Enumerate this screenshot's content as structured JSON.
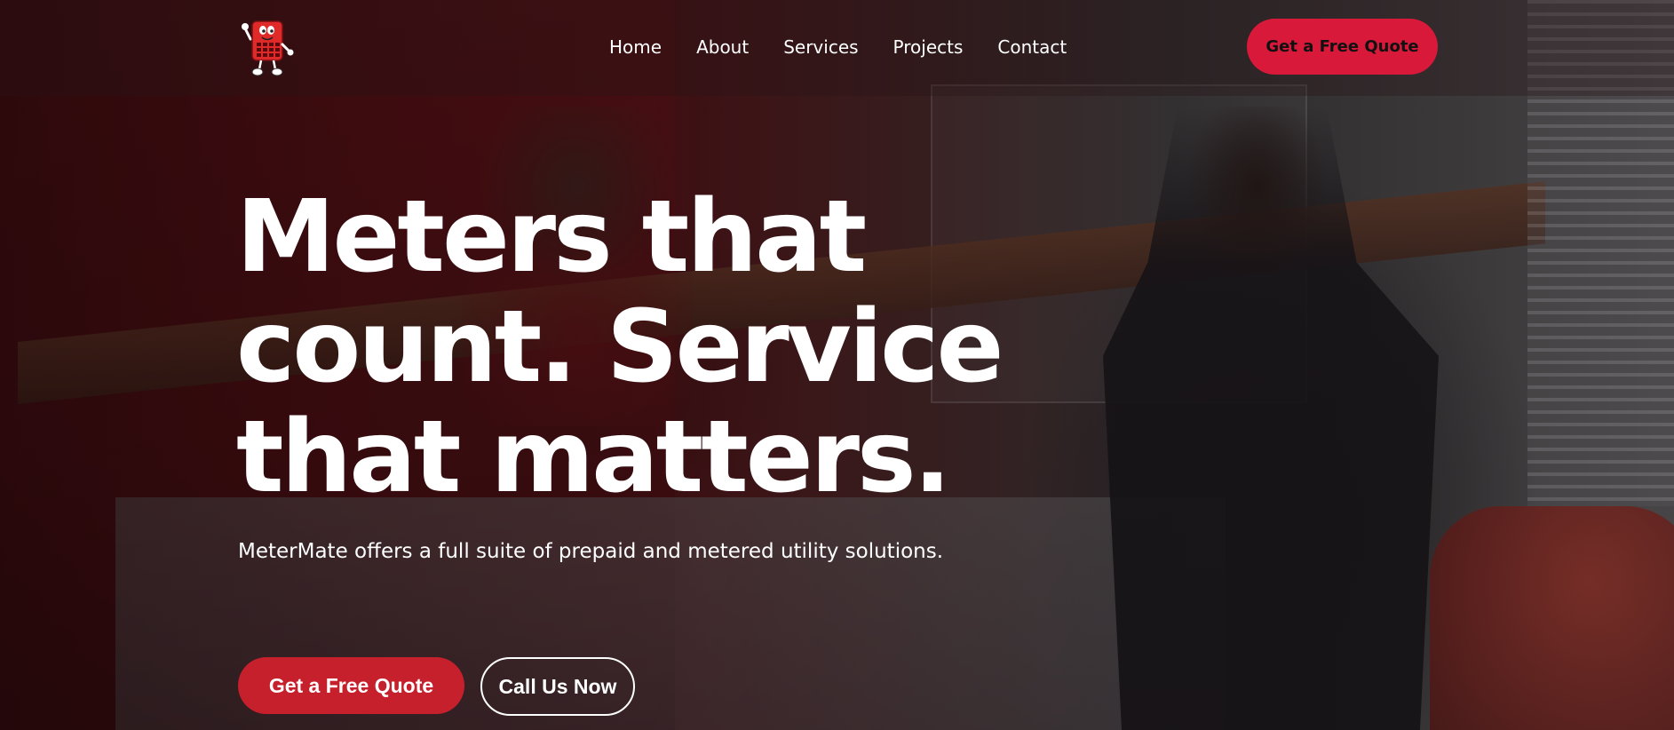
{
  "brand": {
    "logo_icon": "meter-mascot-icon",
    "accent_color": "#d8193a",
    "button_red": "#c7202d"
  },
  "nav": {
    "items": [
      "Home",
      "About",
      "Services",
      "Projects",
      "Contact"
    ]
  },
  "header": {
    "cta_label": "Get a Free Quote"
  },
  "hero": {
    "title_lines": [
      "Meters that",
      "count. Service",
      "that matters."
    ],
    "subtitle": "MeterMate offers a full suite of prepaid and metered utility solutions.",
    "primary_button": "Get a Free Quote",
    "secondary_button": "Call Us Now"
  }
}
